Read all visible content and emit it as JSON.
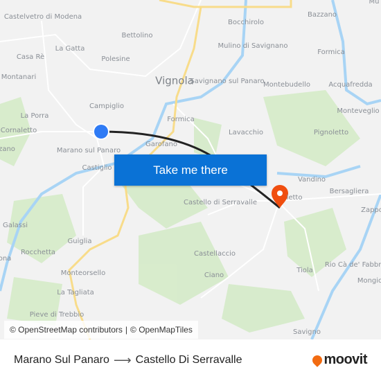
{
  "map": {
    "labels": [
      "Castelvetro di Modena",
      "Bettolino",
      "La Gatta",
      "Casa Rè",
      "Polesine",
      "Montanari",
      "Vignola",
      "Campiglio",
      "La Porra",
      "Cornaletto",
      "Marano sul Panaro",
      "Garofano",
      "zano",
      "Castiglio",
      "Formica",
      "Bocchirolo",
      "Mulino di Savignano",
      "Bazzano",
      "Formica",
      "Savignano sul Panaro",
      "Montebudello",
      "Acquafredda",
      "Monteveglio",
      "Lavacchio",
      "Pignoletto",
      "La Torre",
      "Vandino",
      "Bersagliera",
      "Castello di Serravalle",
      "letto",
      "Zappo",
      "Galassi",
      "Guiglia",
      "Rocchetta",
      "ona",
      "Castellaccio",
      "Rio Cà de' Fabbri",
      "Ciano",
      "Tiola",
      "Monteorsello",
      "Mongio",
      "La Tagliata",
      "Pieve di Trebbio",
      "Savigno",
      "Mu"
    ],
    "cta_label": "Take me there",
    "attribution": [
      "© OpenStreetMap contributors",
      "|",
      "© OpenMapTiles"
    ],
    "origin_icon": "origin-dot-icon",
    "destination_icon": "map-pin-icon",
    "colors": {
      "route": "#222222",
      "origin": "#2f7bf5",
      "destination": "#f04e0f",
      "cta": "#0a72d6",
      "water": "#a8d4f5",
      "forest": "#d5ebc8",
      "highway": "#fbe9a0"
    }
  },
  "footer": {
    "from": "Marano Sul Panaro",
    "arrow_icon": "arrow-right-icon",
    "to": "Castello Di Serravalle",
    "brand": "moovit"
  }
}
